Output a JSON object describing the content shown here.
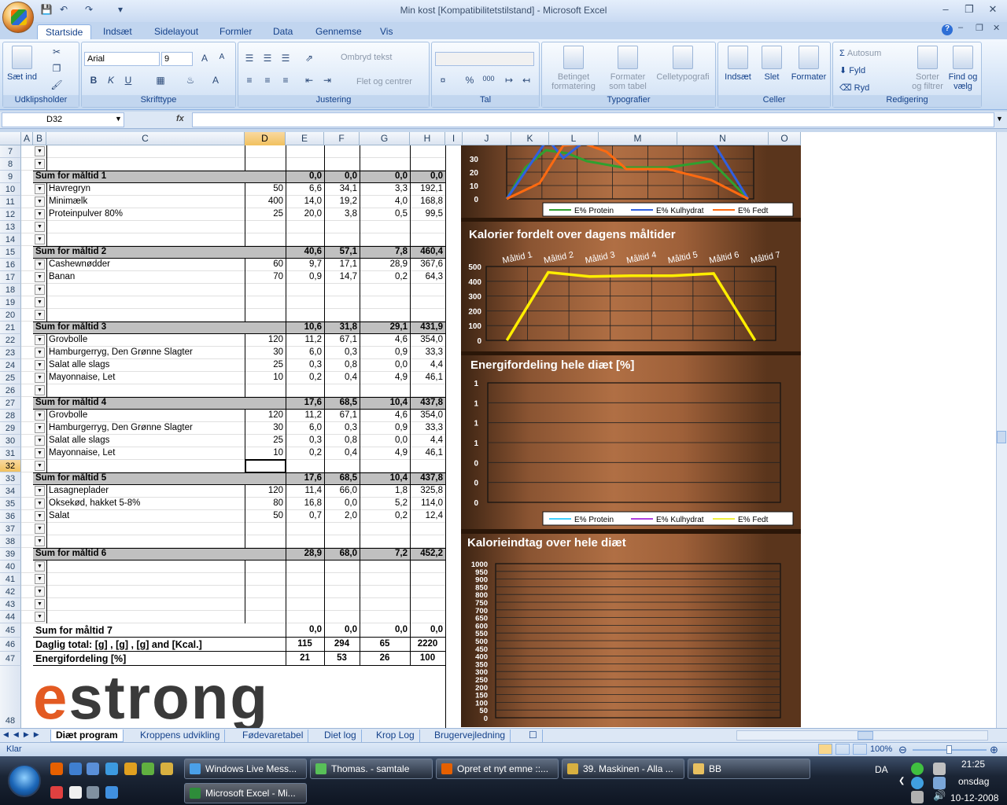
{
  "window": {
    "title": "Min kost  [Kompatibilitetstilstand] - Microsoft Excel"
  },
  "ribbon_tabs": [
    "Startside",
    "Indsæt",
    "Sidelayout",
    "Formler",
    "Data",
    "Gennemse",
    "Vis"
  ],
  "ribbon": {
    "clipboard": {
      "label": "Udklipsholder",
      "paste": "Sæt ind"
    },
    "font": {
      "label": "Skrifttype",
      "name": "Arial",
      "size": "9"
    },
    "alignment": {
      "label": "Justering",
      "wrap": "Ombryd tekst",
      "merge": "Flet og centrer"
    },
    "number": {
      "label": "Tal"
    },
    "styles": {
      "label": "Typografier",
      "cond": "Betinget formatering",
      "table": "Formater som tabel",
      "cell": "Celletypografi"
    },
    "cells": {
      "label": "Celler",
      "insert": "Indsæt",
      "delete": "Slet",
      "format": "Formater"
    },
    "editing": {
      "label": "Redigering",
      "autosum": "Autosum",
      "fill": "Fyld",
      "clear": "Ryd",
      "sort": "Sorter og filtrer",
      "find": "Find og vælg"
    }
  },
  "formula_bar": {
    "name_box": "D32",
    "fx": "fx",
    "formula": ""
  },
  "columns": [
    "A",
    "B",
    "C",
    "D",
    "E",
    "F",
    "G",
    "H",
    "I",
    "J",
    "K",
    "L",
    "M",
    "N",
    "O"
  ],
  "rows": [
    {
      "n": "7",
      "dd": true
    },
    {
      "n": "8",
      "dd": true
    },
    {
      "n": "9",
      "sum": true,
      "c": "Sum for måltid 1",
      "e": "0,0",
      "f": "0,0",
      "g": "0,0",
      "h": "0,0"
    },
    {
      "n": "10",
      "dd": true,
      "c": "Havregryn",
      "d": "50",
      "e": "6,6",
      "f": "34,1",
      "g": "3,3",
      "h": "192,1"
    },
    {
      "n": "11",
      "dd": true,
      "c": "Minimælk",
      "d": "400",
      "e": "14,0",
      "f": "19,2",
      "g": "4,0",
      "h": "168,8"
    },
    {
      "n": "12",
      "dd": true,
      "c": "Proteinpulver 80%",
      "d": "25",
      "e": "20,0",
      "f": "3,8",
      "g": "0,5",
      "h": "99,5"
    },
    {
      "n": "13",
      "dd": true
    },
    {
      "n": "14",
      "dd": true
    },
    {
      "n": "15",
      "sum": true,
      "c": "Sum for måltid 2",
      "e": "40,6",
      "f": "57,1",
      "g": "7,8",
      "h": "460,4"
    },
    {
      "n": "16",
      "dd": true,
      "c": "Cashewnødder",
      "d": "60",
      "e": "9,7",
      "f": "17,1",
      "g": "28,9",
      "h": "367,6"
    },
    {
      "n": "17",
      "dd": true,
      "c": "Banan",
      "d": "70",
      "e": "0,9",
      "f": "14,7",
      "g": "0,2",
      "h": "64,3"
    },
    {
      "n": "18",
      "dd": true
    },
    {
      "n": "19",
      "dd": true
    },
    {
      "n": "20",
      "dd": true
    },
    {
      "n": "21",
      "sum": true,
      "c": "Sum for måltid 3",
      "e": "10,6",
      "f": "31,8",
      "g": "29,1",
      "h": "431,9"
    },
    {
      "n": "22",
      "dd": true,
      "c": "Grovbolle",
      "d": "120",
      "e": "11,2",
      "f": "67,1",
      "g": "4,6",
      "h": "354,0"
    },
    {
      "n": "23",
      "dd": true,
      "c": "Hamburgerryg, Den Grønne Slagter",
      "d": "30",
      "e": "6,0",
      "f": "0,3",
      "g": "0,9",
      "h": "33,3"
    },
    {
      "n": "24",
      "dd": true,
      "c": "Salat alle slags",
      "d": "25",
      "e": "0,3",
      "f": "0,8",
      "g": "0,0",
      "h": "4,4"
    },
    {
      "n": "25",
      "dd": true,
      "c": "Mayonnaise, Let",
      "d": "10",
      "e": "0,2",
      "f": "0,4",
      "g": "4,9",
      "h": "46,1"
    },
    {
      "n": "26",
      "dd": true
    },
    {
      "n": "27",
      "sum": true,
      "c": "Sum for måltid 4",
      "e": "17,6",
      "f": "68,5",
      "g": "10,4",
      "h": "437,8"
    },
    {
      "n": "28",
      "dd": true,
      "c": "Grovbolle",
      "d": "120",
      "e": "11,2",
      "f": "67,1",
      "g": "4,6",
      "h": "354,0"
    },
    {
      "n": "29",
      "dd": true,
      "c": "Hamburgerryg, Den Grønne Slagter",
      "d": "30",
      "e": "6,0",
      "f": "0,3",
      "g": "0,9",
      "h": "33,3"
    },
    {
      "n": "30",
      "dd": true,
      "c": "Salat alle slags",
      "d": "25",
      "e": "0,3",
      "f": "0,8",
      "g": "0,0",
      "h": "4,4"
    },
    {
      "n": "31",
      "dd": true,
      "c": "Mayonnaise, Let",
      "d": "10",
      "e": "0,2",
      "f": "0,4",
      "g": "4,9",
      "h": "46,1"
    },
    {
      "n": "32",
      "dd": true,
      "selected": true
    },
    {
      "n": "33",
      "sum": true,
      "c": "Sum for måltid 5",
      "e": "17,6",
      "f": "68,5",
      "g": "10,4",
      "h": "437,8"
    },
    {
      "n": "34",
      "dd": true,
      "c": "Lasagneplader",
      "d": "120",
      "e": "11,4",
      "f": "66,0",
      "g": "1,8",
      "h": "325,8"
    },
    {
      "n": "35",
      "dd": true,
      "c": "Oksekød, hakket 5-8%",
      "d": "80",
      "e": "16,8",
      "f": "0,0",
      "g": "5,2",
      "h": "114,0"
    },
    {
      "n": "36",
      "dd": true,
      "c": "Salat",
      "d": "50",
      "e": "0,7",
      "f": "2,0",
      "g": "0,2",
      "h": "12,4"
    },
    {
      "n": "37",
      "dd": true
    },
    {
      "n": "38",
      "dd": true
    },
    {
      "n": "39",
      "sum": true,
      "c": "Sum for måltid 6",
      "e": "28,9",
      "f": "68,0",
      "g": "7,2",
      "h": "452,2"
    },
    {
      "n": "40",
      "dd": true
    },
    {
      "n": "41",
      "dd": true
    },
    {
      "n": "42",
      "dd": true
    },
    {
      "n": "43",
      "dd": true
    },
    {
      "n": "44",
      "dd": true
    },
    {
      "n": "45",
      "total": true,
      "c": "Sum for måltid 7",
      "e": "0,0",
      "f": "0,0",
      "g": "0,0",
      "h": "0,0"
    },
    {
      "n": "46",
      "total": true,
      "c": "Daglig total: [g] , [g] , [g] and [Kcal.]",
      "e": "115",
      "f": "294",
      "g": "65",
      "h": "2220"
    },
    {
      "n": "47",
      "total": true,
      "c": "Energifordeling  [%]",
      "e": "21",
      "f": "53",
      "g": "26",
      "h": "100"
    },
    {
      "n": "48"
    }
  ],
  "logo": {
    "e": "e",
    "rest": "strong"
  },
  "chart_data": [
    {
      "type": "line",
      "title": "",
      "y_ticks": [
        "0",
        "10",
        "20",
        "30"
      ],
      "series": [
        {
          "name": "E% Protein",
          "color": "#2fa02f"
        },
        {
          "name": "E% Kulhydrat",
          "color": "#3060e0"
        },
        {
          "name": "E% Fedt",
          "color": "#ff6a10"
        }
      ]
    },
    {
      "type": "line",
      "title": "Kalorier fordelt over dagens måltider",
      "categories": [
        "Måltid 1",
        "Måltid 2",
        "Måltid 3",
        "Måltid 4",
        "Måltid 5",
        "Måltid 6",
        "Måltid 7"
      ],
      "y_ticks": [
        "0",
        "100",
        "200",
        "300",
        "400",
        "500"
      ],
      "ylim": [
        0,
        500
      ],
      "series": [
        {
          "values": [
            0,
            460.4,
            431.9,
            437.8,
            437.8,
            452.2,
            0
          ],
          "color": "#ffee00"
        }
      ]
    },
    {
      "type": "line",
      "title": "Energifordeling hele diæt [%]",
      "y_ticks": [
        "1",
        "1",
        "1",
        "1",
        "0",
        "0",
        "0"
      ],
      "series": [
        {
          "name": "E% Protein",
          "color": "#40d0ff"
        },
        {
          "name": "E% Kulhydrat",
          "color": "#b040e0"
        },
        {
          "name": "E% Fedt",
          "color": "#f0f040"
        }
      ]
    },
    {
      "type": "line",
      "title": "Kalorieindtag over hele diæt",
      "y_ticks": [
        "1000",
        "950",
        "900",
        "850",
        "800",
        "750",
        "700",
        "650",
        "600",
        "550",
        "500",
        "450",
        "400",
        "350",
        "300",
        "250",
        "200",
        "150",
        "100",
        "50",
        "0"
      ],
      "ylim": [
        0,
        1000
      ]
    }
  ],
  "sheet_tabs": [
    "Diæt program",
    "Kroppens udvikling",
    "Fødevaretabel",
    "Diet log",
    "Krop Log",
    "Brugervejledning"
  ],
  "status": {
    "ready": "Klar",
    "zoom": "100%"
  },
  "taskbar": {
    "buttons": [
      "Windows Live Mess...",
      "Thomas. - samtale",
      "Opret et nyt emne ::...",
      "39. Maskinen - Alla ...",
      "BB",
      "Microsoft Excel - Mi..."
    ],
    "lang": "DA",
    "time": "21:25",
    "day": "onsdag",
    "date": "10-12-2008"
  }
}
